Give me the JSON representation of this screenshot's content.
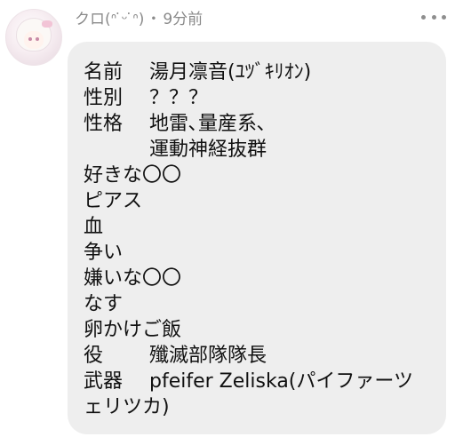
{
  "post": {
    "username": "クロ(ᐢ ̇ᵕ ̇ᐢ)",
    "separator": "・",
    "time": "9分前",
    "more_icon": "more-dots-icon"
  },
  "profile": {
    "name_label": "名前",
    "name_value": "湯月凛音(ﾕﾂﾞｷﾘｵﾝ)",
    "gender_label": "性別",
    "gender_value": "？？？",
    "personality_label": "性格",
    "personality_value_1": "地雷､量産系､",
    "personality_value_2": "運動神経抜群",
    "likes_heading": "好きな〇〇",
    "likes": [
      "ピアス",
      "血",
      "争い"
    ],
    "dislikes_heading": "嫌いな〇〇",
    "dislikes": [
      "なす",
      "卵かけご飯"
    ],
    "role_label": "役",
    "role_value": "殲滅部隊隊長",
    "weapon_label": "武器",
    "weapon_value_1": "pfeifer Zeliska(パイファーツ",
    "weapon_value_2": "ェリツカ)"
  }
}
